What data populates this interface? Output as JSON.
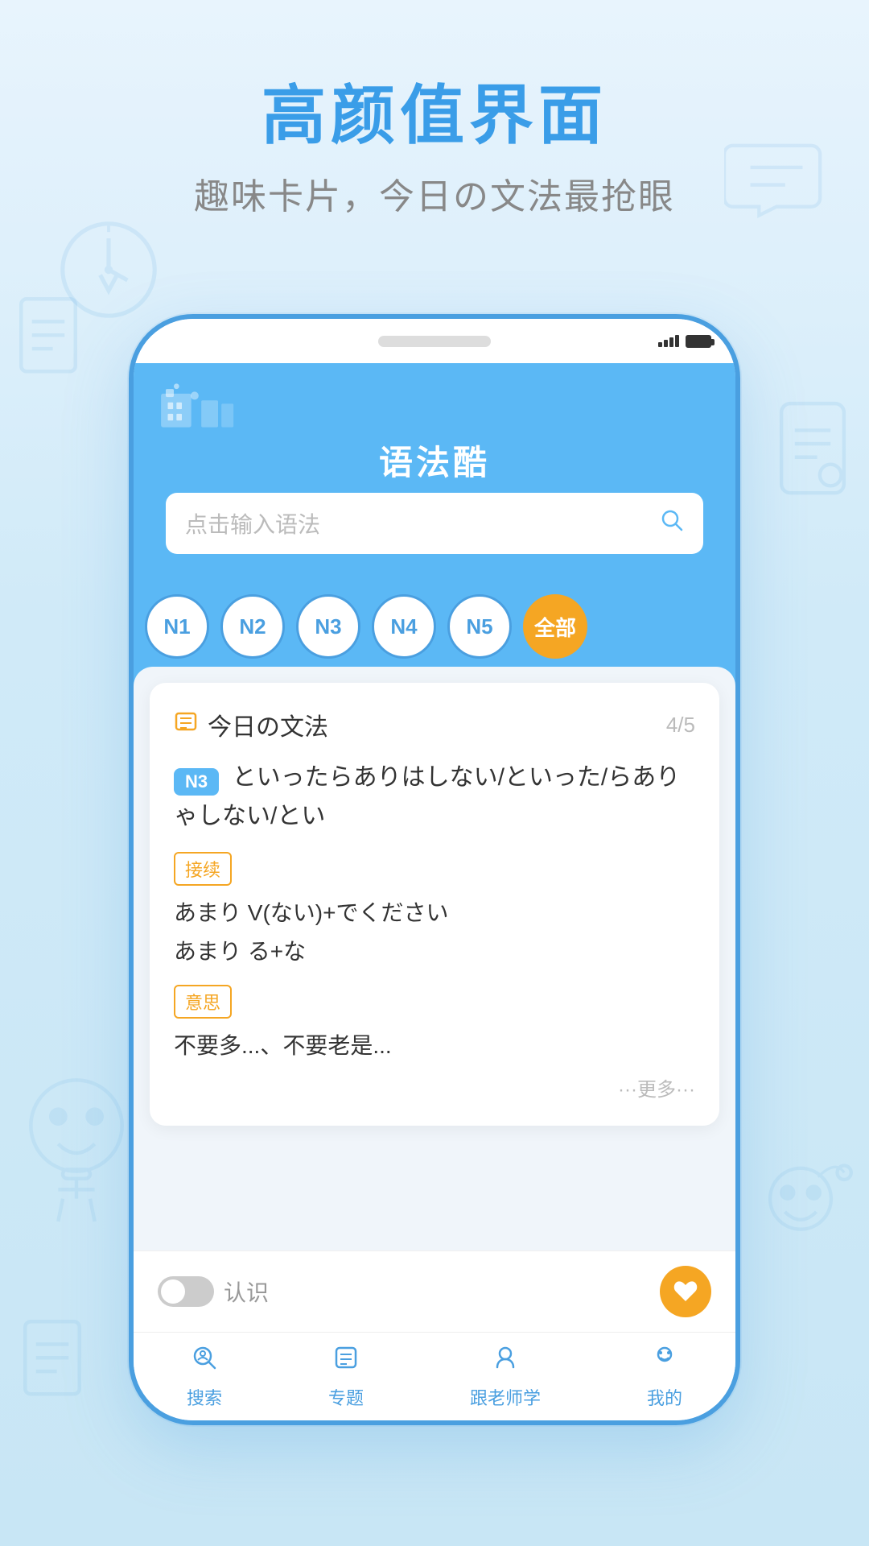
{
  "page": {
    "background_gradient": [
      "#e8f4fd",
      "#c8e6f5"
    ],
    "main_title": "高颜值界面",
    "sub_title": "趣味卡片，今日の文法最抢眼"
  },
  "phone": {
    "speaker_color": "#ddd",
    "status": {
      "signal": "full",
      "battery": "full"
    }
  },
  "app": {
    "title": "语法酷",
    "search_placeholder": "点击输入语法",
    "levels": [
      {
        "label": "N1",
        "active": false
      },
      {
        "label": "N2",
        "active": false
      },
      {
        "label": "N3",
        "active": false
      },
      {
        "label": "N4",
        "active": false
      },
      {
        "label": "N5",
        "active": false
      },
      {
        "label": "全部",
        "active": true
      }
    ],
    "card": {
      "title": "今日の文法",
      "progress": "4/5",
      "grammar_level": "N3",
      "grammar_title": "といったらありはしない/といった/らありゃしない/とい",
      "label_jixu": "接续",
      "jixu_content": "あまり V(ない)+でください\nあまり る+な",
      "label_yisi": "意思",
      "yisi_content": "不要多...、不要老是...",
      "more_text": "···更多···"
    },
    "bottom_action": {
      "toggle_off": true,
      "recognize_label": "认识",
      "like_icon": "♥"
    },
    "nav": [
      {
        "icon": "🔍",
        "label": "搜索"
      },
      {
        "icon": "📋",
        "label": "专题"
      },
      {
        "icon": "👤",
        "label": "跟老师学"
      },
      {
        "icon": "😊",
        "label": "我的"
      }
    ]
  }
}
